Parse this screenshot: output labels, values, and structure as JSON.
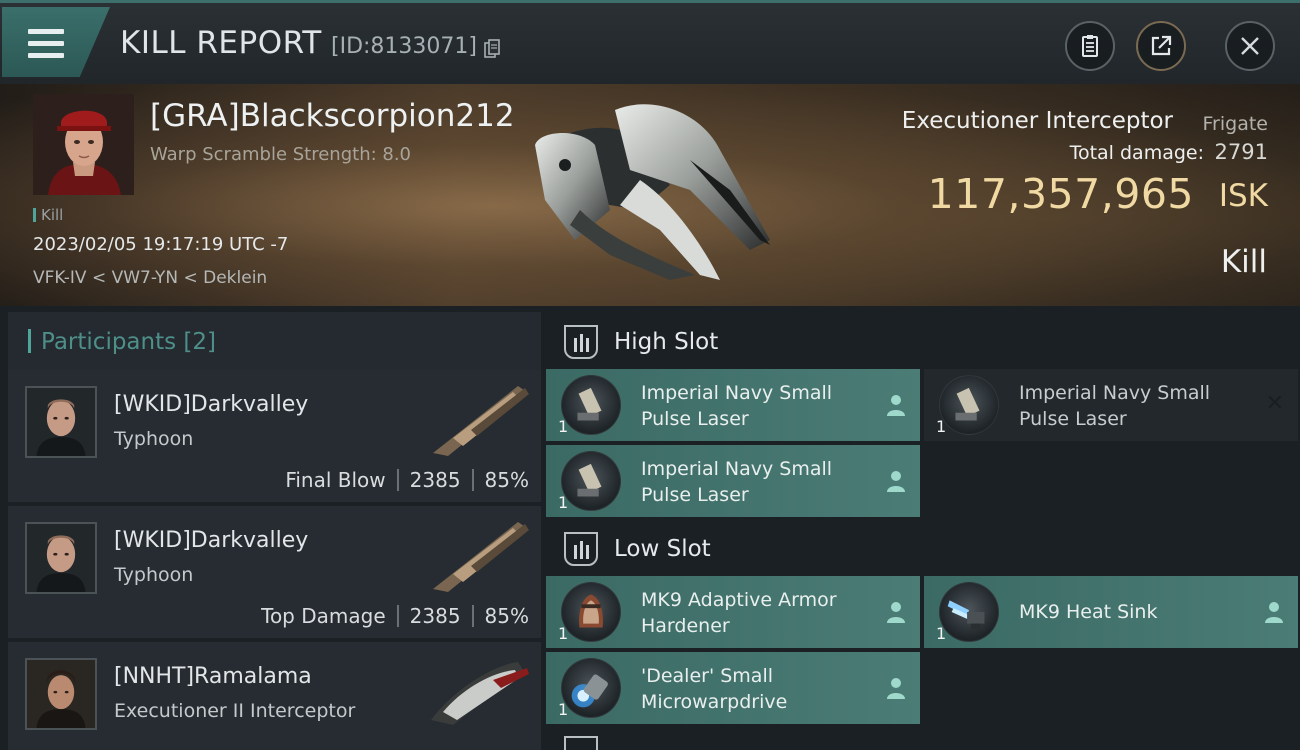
{
  "window": {
    "title": "KILL REPORT",
    "kill_id": "[ID:8133071]"
  },
  "victim": {
    "name": "[GRA]Blackscorpion212",
    "warp_scramble": "Warp Scramble Strength: 8.0",
    "tag": "Kill",
    "datetime": "2023/02/05 19:17:19 UTC -7",
    "location": "VFK-IV < VW7-YN < Deklein",
    "ship_name": "Executioner Interceptor",
    "ship_class": "Frigate",
    "total_damage_label": "Total damage:",
    "total_damage": "2791",
    "isk_value": "117,357,965",
    "isk_unit": "ISK",
    "result": "Kill"
  },
  "participants": {
    "title": "Participants",
    "count": "[2]",
    "rows": [
      {
        "name": "[WKID]Darkvalley",
        "ship": "Typhoon",
        "role": "Final Blow",
        "damage": "2385",
        "percent": "85%"
      },
      {
        "name": "[WKID]Darkvalley",
        "ship": "Typhoon",
        "role": "Top Damage",
        "damage": "2385",
        "percent": "85%"
      },
      {
        "name": "[NNHT]Ramalama",
        "ship": "Executioner II Interceptor"
      }
    ]
  },
  "fittings": {
    "high_slot": {
      "title": "High Slot",
      "modules": [
        {
          "name_line1": "Imperial Navy Small",
          "name_line2": "Pulse Laser",
          "qty": "1",
          "state": "dropped"
        },
        {
          "name_line1": "Imperial Navy Small",
          "name_line2": "Pulse Laser",
          "qty": "1",
          "state": "destroyed"
        },
        {
          "name_line1": "Imperial Navy Small",
          "name_line2": "Pulse Laser",
          "qty": "1",
          "state": "dropped"
        }
      ]
    },
    "low_slot": {
      "title": "Low Slot",
      "modules": [
        {
          "name_line1": "MK9 Adaptive Armor",
          "name_line2": "Hardener",
          "qty": "1",
          "state": "dropped"
        },
        {
          "name_line1": "MK9 Heat Sink",
          "name_line2": "",
          "qty": "1",
          "state": "dropped"
        },
        {
          "name_line1": "'Dealer' Small",
          "name_line2": "Microwarpdrive",
          "qty": "1",
          "state": "dropped"
        }
      ]
    }
  },
  "colors": {
    "accent_teal": "#4fa59a",
    "isk_gold": "#f0d9a3",
    "module_dropped": "#4b7c75",
    "module_destroyed": "#22282c"
  },
  "icons": [
    "menu-icon",
    "clipboard-icon",
    "share-icon",
    "close-icon",
    "copy-icon",
    "slot-icon",
    "person-icon"
  ]
}
